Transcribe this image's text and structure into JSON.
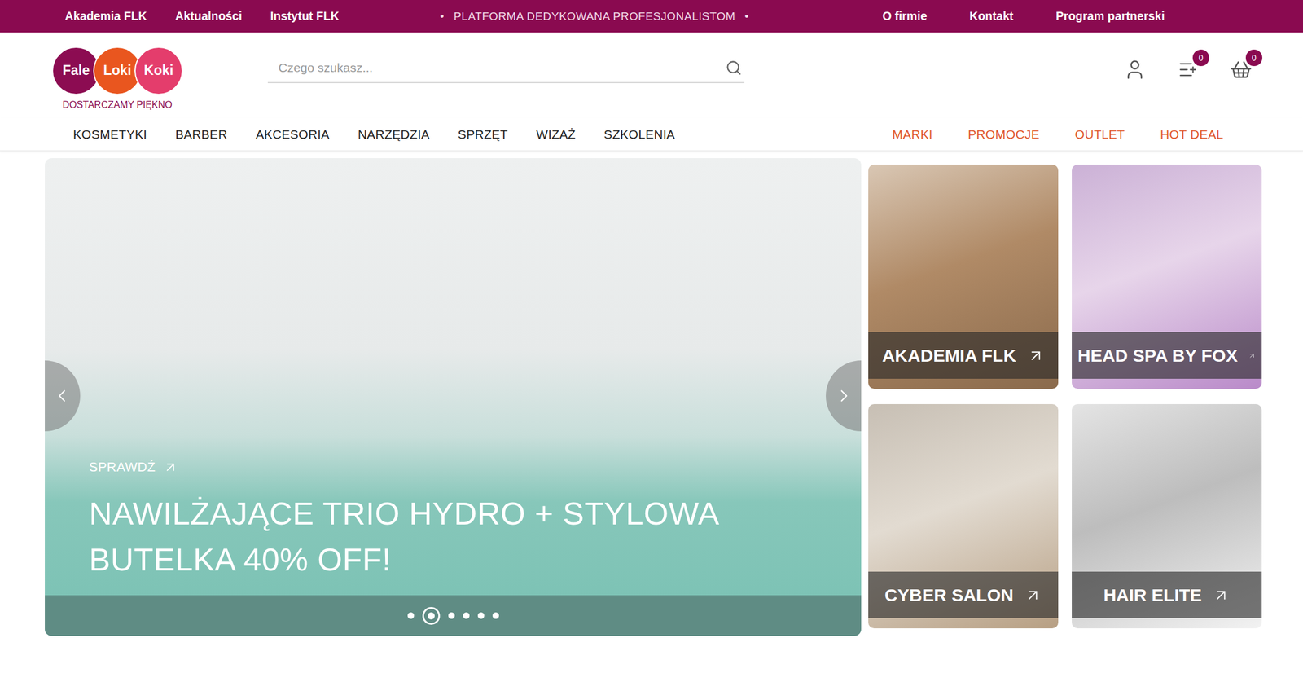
{
  "top_bar": {
    "left_links": [
      "Akademia FLK",
      "Aktualności",
      "Instytut FLK"
    ],
    "bullet": "•",
    "tagline": "PLATFORMA DEDYKOWANA PROFESJONALISTOM",
    "right_links": [
      "O firmie",
      "Kontakt",
      "Program partnerski"
    ]
  },
  "logo": {
    "words": [
      {
        "text": "Fale",
        "color": "#8c0c52"
      },
      {
        "text": "Loki",
        "color": "#e9561f"
      },
      {
        "text": "Koki",
        "color": "#e43d6c"
      }
    ],
    "tagline": "DOSTARCZAMY PIĘKNO"
  },
  "search": {
    "placeholder": "Czego szukasz..."
  },
  "header_icons": {
    "wishlist_count": "0",
    "cart_count": "0"
  },
  "nav": {
    "main": [
      "KOSMETYKI",
      "BARBER",
      "AKCESORIA",
      "NARZĘDZIA",
      "SPRZĘT",
      "WIZAŻ",
      "SZKOLENIA"
    ],
    "featured": [
      "MARKI",
      "PROMOCJE",
      "OUTLET",
      "HOT DEAL"
    ]
  },
  "hero": {
    "cta": "SPRAWDŹ",
    "title": "NAWILŻAJĄCE TRIO HYDRO + STYLOWA BUTELKA 40% OFF!",
    "slides": [
      {
        "selected": false
      },
      {
        "selected": true
      },
      {
        "selected": false
      },
      {
        "selected": false
      },
      {
        "selected": false
      },
      {
        "selected": false
      }
    ]
  },
  "tiles": [
    {
      "label": "AKADEMIA FLK"
    },
    {
      "label": "HEAD SPA BY FOX"
    },
    {
      "label": "CYBER SALON"
    },
    {
      "label": "HAIR ELITE"
    }
  ]
}
